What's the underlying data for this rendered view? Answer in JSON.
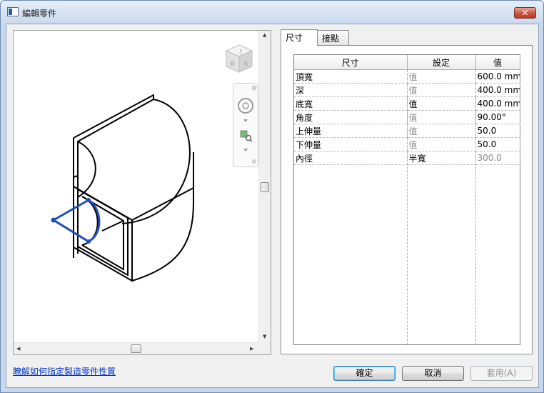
{
  "window": {
    "title": "編輯零件",
    "close_label": "✕"
  },
  "tabs": [
    {
      "label": "尺寸"
    },
    {
      "label": "接點"
    }
  ],
  "table": {
    "headers": [
      "尺寸",
      "設定",
      "值"
    ],
    "rows": [
      {
        "name": "頂寬",
        "setting": "值",
        "value": "600.0 mm",
        "setting_gray": true,
        "value_gray": false
      },
      {
        "name": "深",
        "setting": "值",
        "value": "400.0 mm",
        "setting_gray": true,
        "value_gray": false
      },
      {
        "name": "底寬",
        "setting": "值",
        "value": "400.0 mm",
        "setting_gray": false,
        "value_gray": false
      },
      {
        "name": "角度",
        "setting": "值",
        "value": "90.00°",
        "setting_gray": true,
        "value_gray": false
      },
      {
        "name": "上伸量",
        "setting": "值",
        "value": "50.0",
        "setting_gray": true,
        "value_gray": false
      },
      {
        "name": "下伸量",
        "setting": "值",
        "value": "50.0",
        "setting_gray": true,
        "value_gray": false
      },
      {
        "name": "內徑",
        "setting": "半寬",
        "value": "300.0",
        "setting_gray": false,
        "value_gray": true
      }
    ]
  },
  "footer": {
    "help_link": "瞭解如何指定製造零件性質",
    "ok": "確定",
    "cancel": "取消",
    "apply": "套用(A)"
  },
  "colors": {
    "selection_blue": "#1f4fb4",
    "link": "#0033cc"
  }
}
